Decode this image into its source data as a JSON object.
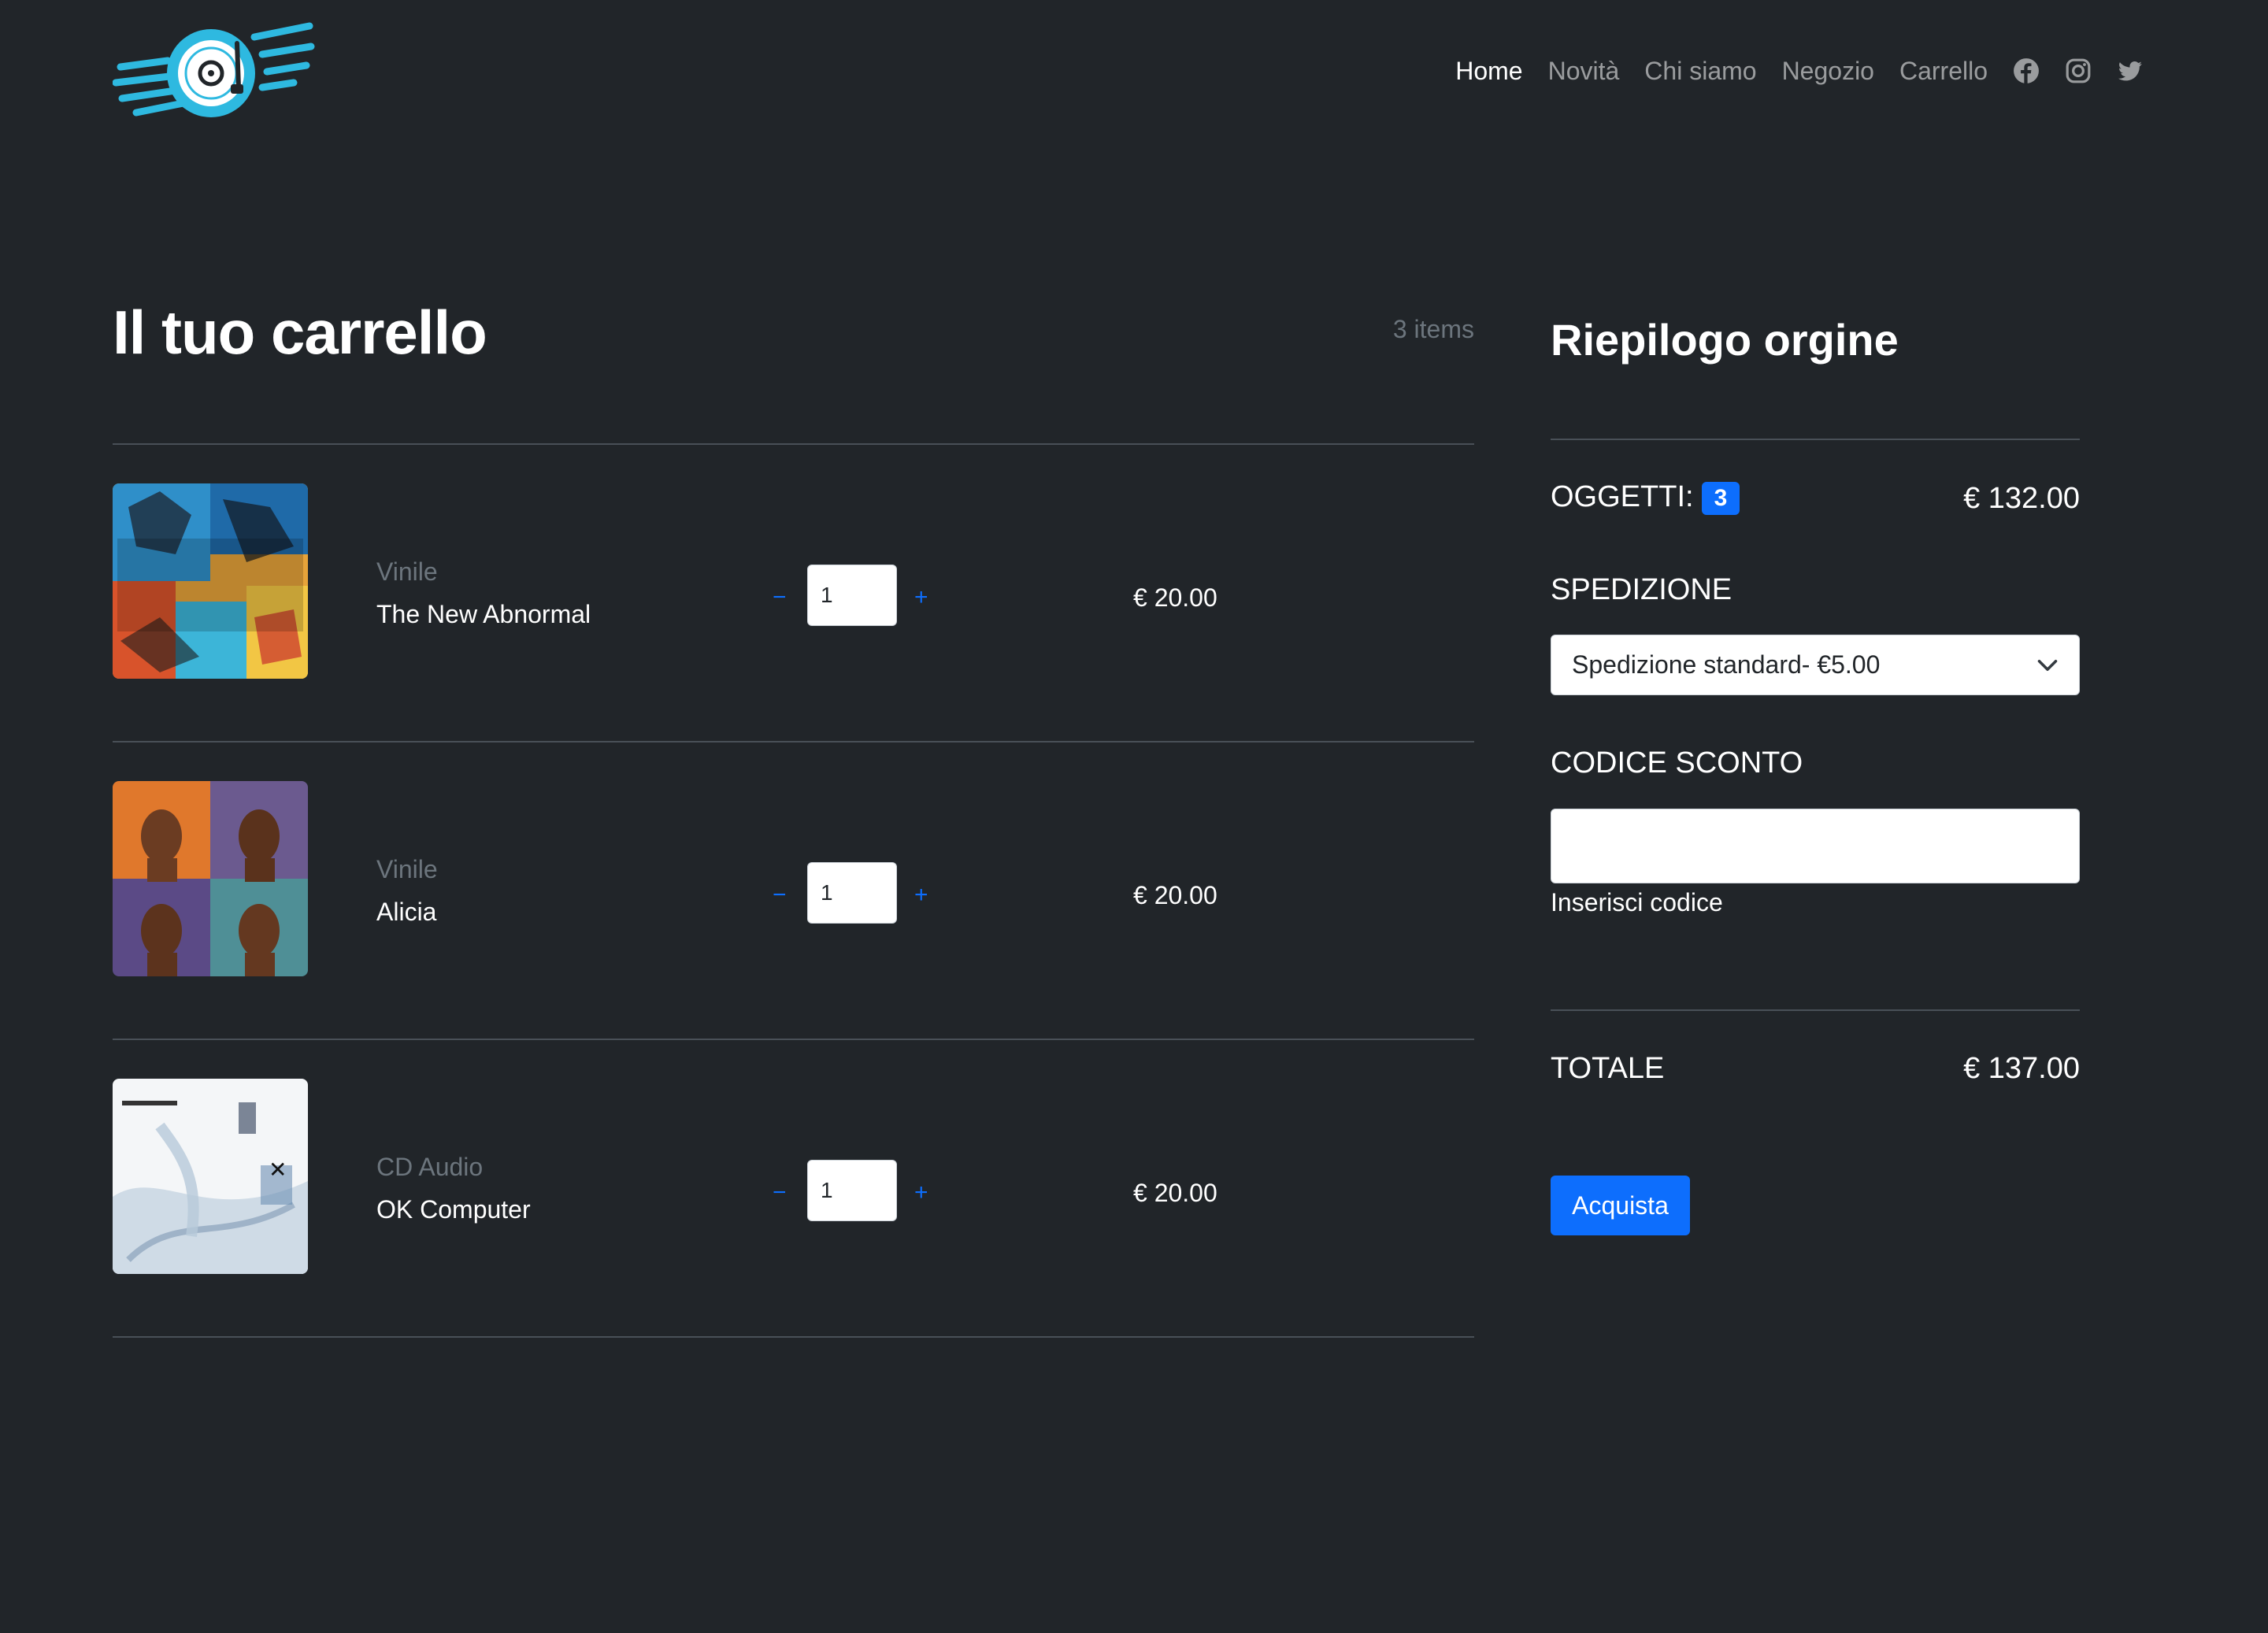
{
  "nav": {
    "links": [
      {
        "label": "Home",
        "active": true
      },
      {
        "label": "Novità",
        "active": false
      },
      {
        "label": "Chi siamo",
        "active": false
      },
      {
        "label": "Negozio",
        "active": false
      },
      {
        "label": "Carrello",
        "active": false
      }
    ],
    "social_icons": [
      "facebook-icon",
      "instagram-icon",
      "twitter-icon"
    ]
  },
  "cart": {
    "title": "Il tuo carrello",
    "items_count": "3 items",
    "items": [
      {
        "category": "Vinile",
        "title": "The New Abnormal",
        "quantity": "1",
        "price": "€ 20.00",
        "cover_icon": "the-new-abnormal-cover"
      },
      {
        "category": "Vinile",
        "title": "Alicia",
        "quantity": "1",
        "price": "€ 20.00",
        "cover_icon": "alicia-cover"
      },
      {
        "category": "CD Audio",
        "title": "OK Computer",
        "quantity": "1",
        "price": "€ 20.00",
        "cover_icon": "ok-computer-cover"
      }
    ],
    "minus_symbol": "−",
    "plus_symbol": "+"
  },
  "summary": {
    "title": "Riepilogo orgine",
    "items_label": "OGGETTI:",
    "items_badge": "3",
    "items_total": "€ 132.00",
    "shipping_label": "SPEDIZIONE",
    "shipping_selected": "Spedizione standard- €5.00",
    "discount_label": "CODICE SCONTO",
    "discount_value": "",
    "discount_hint": "Inserisci codice",
    "total_label": "TOTALE",
    "total_value": "€ 137.00",
    "buy_label": "Acquista"
  },
  "colors": {
    "background": "#212529",
    "accent": "#0d6efd",
    "logo": "#2eb9e0",
    "muted": "#6c757d"
  }
}
